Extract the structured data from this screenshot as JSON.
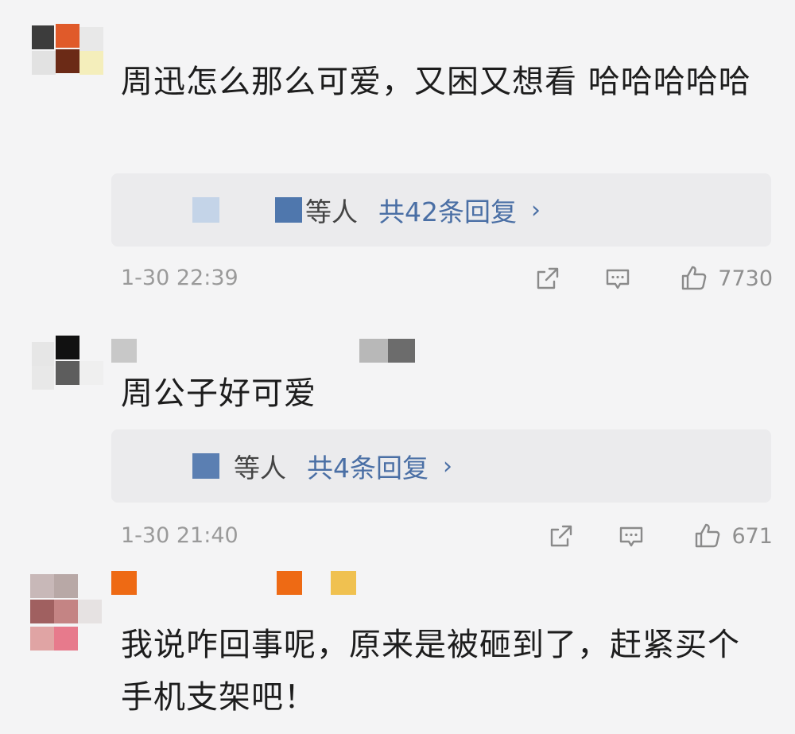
{
  "comments": [
    {
      "text": "周迅怎么那么可爱，又困又想看 哈哈哈哈哈",
      "reply_who": "等人",
      "reply_count": "共42条回复",
      "chevron": "›",
      "time": "1-30 22:39",
      "likes": "7730"
    },
    {
      "text": "周公子好可爱",
      "reply_who": "等人",
      "reply_count": "共4条回复",
      "chevron": "›",
      "time": "1-30 21:40",
      "likes": "671"
    },
    {
      "text": "我说咋回事呢，原来是被砸到了，赶紧买个手机支架吧！"
    }
  ],
  "icons": [
    "share-icon",
    "comment-icon",
    "like-icon"
  ],
  "colors": {
    "link": "#4a6fa5",
    "meta": "#9a9a9a",
    "reply_bg": "#ebebed"
  }
}
